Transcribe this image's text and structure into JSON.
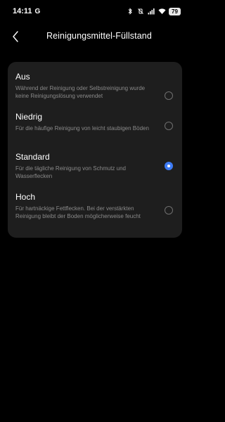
{
  "status_bar": {
    "time": "14:11",
    "g_label": "G",
    "battery": "79",
    "icons": [
      "bluetooth-icon",
      "mute-vibrate-icon",
      "signal-icon",
      "wifi-icon"
    ]
  },
  "header": {
    "title": "Reinigungsmittel-Füllstand",
    "back_icon": "chevron-left-icon"
  },
  "options": [
    {
      "title": "Aus",
      "description": "Während der Reinigung oder Selbstreinigung wurde keine Reinigungslösung verwendet",
      "selected": false
    },
    {
      "title": "Niedrig",
      "description": "Für die häufige Reinigung von leicht staubigen Böden",
      "selected": false
    },
    {
      "title": "Standard",
      "description": "Für die tägliche Reinigung von Schmutz und Wasserflecken",
      "selected": true
    },
    {
      "title": "Hoch",
      "description": "Für hartnäckige Fettflecken. Bei der verstärkten Reinigung bleibt der Boden möglicherweise feucht",
      "selected": false
    }
  ],
  "colors": {
    "background": "#000000",
    "card": "#1e1e1e",
    "accent": "#3d7bf5",
    "secondary_text": "#8a8a8a"
  }
}
